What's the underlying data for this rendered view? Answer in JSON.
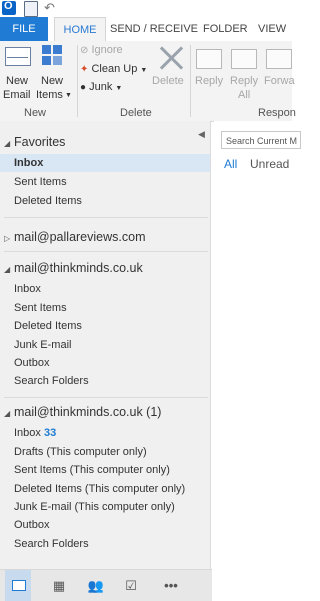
{
  "tabs": {
    "file": "FILE",
    "home": "HOME",
    "send_receive": "SEND / RECEIVE",
    "folder": "FOLDER",
    "view": "VIEW"
  },
  "ribbon": {
    "new_email_line1": "New",
    "new_email_line2": "Email",
    "new_items_line1": "New",
    "new_items_line2": "Items",
    "ignore": "Ignore",
    "clean_up": "Clean Up",
    "junk": "Junk",
    "delete": "Delete",
    "reply": "Reply",
    "reply_all_line1": "Reply",
    "reply_all_line2": "All",
    "forward": "Forwa",
    "group_new": "New",
    "group_delete": "Delete",
    "group_respond": "Respon"
  },
  "nav": {
    "favorites": "Favorites",
    "favorites_items": [
      "Inbox",
      "Sent Items",
      "Deleted Items"
    ],
    "account1": "mail@pallareviews.com",
    "account2": "mail@thinkminds.co.uk",
    "account2_items": [
      "Inbox",
      "Sent Items",
      "Deleted Items",
      "Junk E-mail",
      "Outbox",
      "Search Folders"
    ],
    "account3": "mail@thinkminds.co.uk (1)",
    "account3_inbox": "Inbox",
    "account3_inbox_count": "33",
    "account3_items": [
      "Drafts (This computer only)",
      "Sent Items (This computer only)",
      "Deleted Items (This computer only)",
      "Junk E-mail (This computer only)",
      "Outbox",
      "Search Folders"
    ]
  },
  "list": {
    "search_placeholder": "Search Current M",
    "filter_all": "All",
    "filter_unread": "Unread"
  },
  "colors": {
    "accent": "#1f7bd3",
    "nav_bg": "#f0f0f0",
    "selected": "#d9e7f5"
  }
}
